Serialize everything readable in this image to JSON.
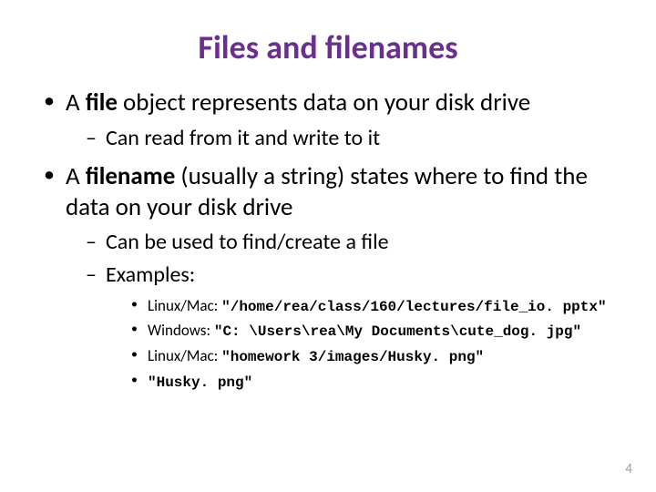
{
  "title": "Files and filenames",
  "bullets": [
    {
      "pre": "A ",
      "strong": "file",
      "post": " object represents data on your disk drive",
      "sub": [
        {
          "text": "Can read from it and write to it"
        }
      ]
    },
    {
      "pre": "A ",
      "strong": "filename",
      "post": " (usually a string) states where to find the data on your disk drive",
      "sub": [
        {
          "text": "Can be used to find/create a file"
        },
        {
          "text": "Examples:",
          "examples": [
            {
              "prefix": "Linux/Mac: ",
              "code": "\"/home/rea/class/160/lectures/file_io. pptx\""
            },
            {
              "prefix": "Windows: ",
              "code": "\"C: \\Users\\rea\\My Documents\\cute_dog. jpg\""
            },
            {
              "prefix": "Linux/Mac: ",
              "code": "\"homework 3/images/Husky. png\""
            },
            {
              "prefix": "",
              "code": "\"Husky. png\""
            }
          ]
        }
      ]
    }
  ],
  "page_number": "4"
}
